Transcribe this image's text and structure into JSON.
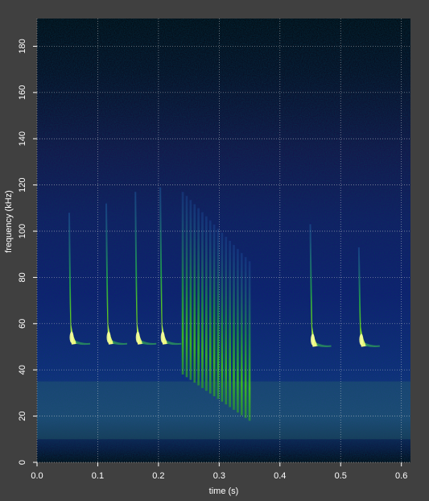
{
  "chart_data": {
    "type": "heatmap",
    "title": "",
    "xlabel": "time (s)",
    "ylabel": "frequency (kHz)",
    "xlim": [
      0.0,
      0.615
    ],
    "ylim": [
      0,
      192
    ],
    "xticks": [
      0.0,
      0.1,
      0.2,
      0.3,
      0.4,
      0.5,
      0.6
    ],
    "xtick_labels": [
      "0.0",
      "0.1",
      "0.2",
      "0.3",
      "0.4",
      "0.5",
      "0.6"
    ],
    "yticks": [
      0,
      20,
      40,
      60,
      80,
      100,
      120,
      140,
      160,
      180
    ],
    "ytick_labels": [
      "0",
      "20",
      "40",
      "60",
      "80",
      "100",
      "120",
      "140",
      "160",
      "180"
    ],
    "grid": true,
    "colormap": "black-blue-green-yellow",
    "calls": [
      {
        "start_time": 0.053,
        "f_high": 108,
        "f_low": 52
      },
      {
        "start_time": 0.114,
        "f_high": 112,
        "f_low": 52
      },
      {
        "start_time": 0.162,
        "f_high": 117,
        "f_low": 52
      },
      {
        "start_time": 0.203,
        "f_high": 119,
        "f_low": 52
      },
      {
        "start_time": 0.45,
        "f_high": 103,
        "f_low": 51
      },
      {
        "start_time": 0.53,
        "f_high": 93,
        "f_low": 51
      }
    ],
    "feeding_buzz": {
      "start_time": 0.24,
      "end_time": 0.35,
      "f_high": 117,
      "f_low": 18
    },
    "noise_band_khz": [
      10,
      35
    ]
  }
}
